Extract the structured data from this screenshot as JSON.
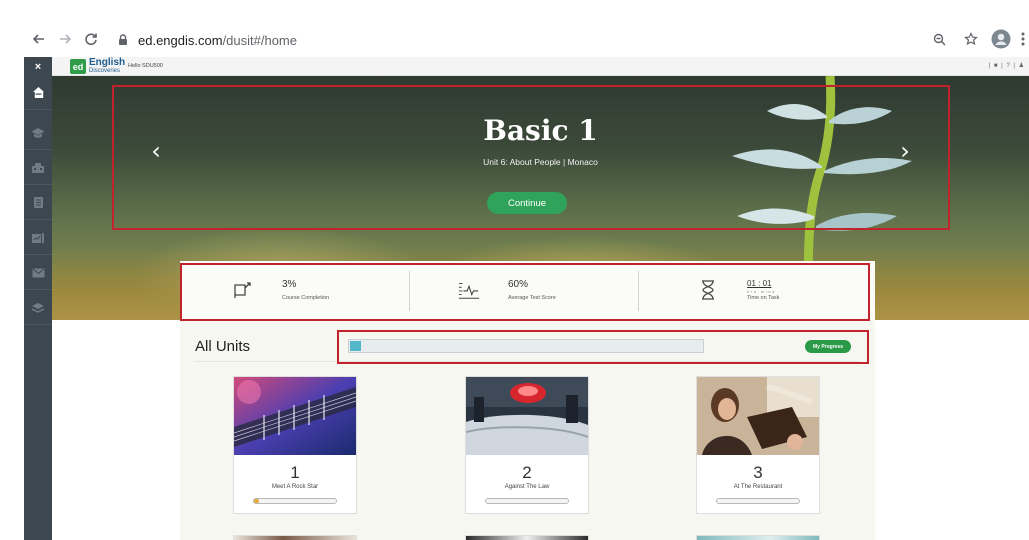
{
  "browser": {
    "url_host": "ed.engdis.com",
    "url_path": "/dusit#/home"
  },
  "appbar": {
    "close_label": "×",
    "logo_mark": "ed",
    "logo_line1": "English",
    "logo_line2": "Discoveries",
    "greeting": "Hello SDU500",
    "right_icons": "| ■ | ? | ♟"
  },
  "sidebar": {
    "items": [
      {
        "icon": "home-icon"
      },
      {
        "icon": "graduation-cap-icon"
      },
      {
        "icon": "community-icon"
      },
      {
        "icon": "document-icon"
      },
      {
        "icon": "chart-icon"
      },
      {
        "icon": "mail-icon"
      },
      {
        "icon": "layers-icon"
      }
    ]
  },
  "hero": {
    "title": "Basic 1",
    "subtitle": "Unit 6: About People | Monaco",
    "continue_label": "Continue",
    "prev_arrow": "‹",
    "next_arrow": "›"
  },
  "stats": {
    "completion_value": "3%",
    "completion_label": "Course Completion",
    "test_value": "60%",
    "test_label": "Average Test Score",
    "time_value": "01 : 01",
    "time_units": "hrs   mins",
    "time_label": "Time on Task"
  },
  "units": {
    "heading": "All Units",
    "progress_fraction": 0.03,
    "my_progress_label": "My Progress",
    "cards": [
      {
        "number": "1",
        "name": "Meet A Rock Star",
        "progress": 0.06
      },
      {
        "number": "2",
        "name": "Against The Law",
        "progress": 0
      },
      {
        "number": "3",
        "name": "At The Restaurant",
        "progress": 0
      }
    ]
  },
  "colors": {
    "accent_green": "#2fa35a",
    "sidebar_dark": "#3d4750",
    "annotation_red": "#c0232b",
    "progress_teal": "#53b7c9"
  }
}
